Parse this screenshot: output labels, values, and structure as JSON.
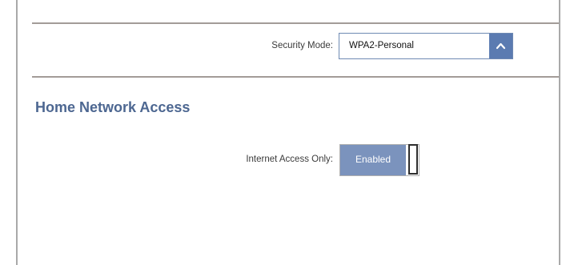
{
  "security": {
    "label": "Security Mode:",
    "selected": "WPA2-Personal",
    "dropdown_icon": "chevron-up-icon"
  },
  "home_network": {
    "title": "Home Network Access",
    "internet_access_only": {
      "label": "Internet Access Only:",
      "value": "Enabled",
      "enabled": true
    }
  },
  "colors": {
    "accent": "#5b7bb1",
    "toggle_fill": "#7b93bd",
    "title": "#4d6791",
    "rule": "#a39c98"
  }
}
